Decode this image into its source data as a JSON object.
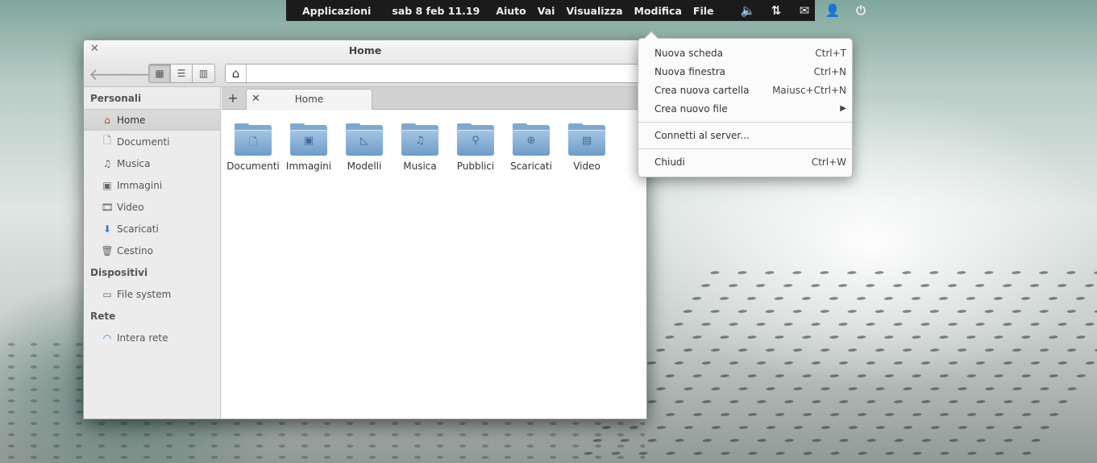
{
  "panel": {
    "apps": "Applicazioni",
    "clock": "sab  8 feb 11.19",
    "menus": [
      "Aiuto",
      "Vai",
      "Visualizza",
      "Modifica",
      "File"
    ],
    "indicators": [
      "volume-icon",
      "network-icon",
      "mail-icon",
      "user-icon",
      "power-icon"
    ]
  },
  "window": {
    "title": "Home",
    "tab_label": "Home"
  },
  "sidebar": {
    "sections": [
      {
        "header": "Personali",
        "items": [
          {
            "label": "Home",
            "icon": "home-icon"
          },
          {
            "label": "Documenti",
            "icon": "document-icon"
          },
          {
            "label": "Musica",
            "icon": "music-icon"
          },
          {
            "label": "Immagini",
            "icon": "image-icon"
          },
          {
            "label": "Video",
            "icon": "video-icon"
          },
          {
            "label": "Scaricati",
            "icon": "download-icon"
          },
          {
            "label": "Cestino",
            "icon": "trash-icon"
          }
        ]
      },
      {
        "header": "Dispositivi",
        "items": [
          {
            "label": "File system",
            "icon": "drive-icon"
          }
        ]
      },
      {
        "header": "Rete",
        "items": [
          {
            "label": "Intera rete",
            "icon": "wifi-icon"
          }
        ]
      }
    ]
  },
  "folders": [
    "Documenti",
    "Immagini",
    "Modelli",
    "Musica",
    "Pubblici",
    "Scaricati",
    "Video"
  ],
  "file_menu": {
    "items": [
      {
        "label": "Nuova scheda",
        "accel": "Ctrl+T"
      },
      {
        "label": "Nuova finestra",
        "accel": "Ctrl+N"
      },
      {
        "label": "Crea nuova cartella",
        "accel": "Maiusc+Ctrl+N"
      },
      {
        "label": "Crea nuovo file",
        "accel": "▶"
      },
      {
        "label": "Connetti al server...",
        "accel": ""
      },
      {
        "label": "Chiudi",
        "accel": "Ctrl+W"
      }
    ]
  }
}
